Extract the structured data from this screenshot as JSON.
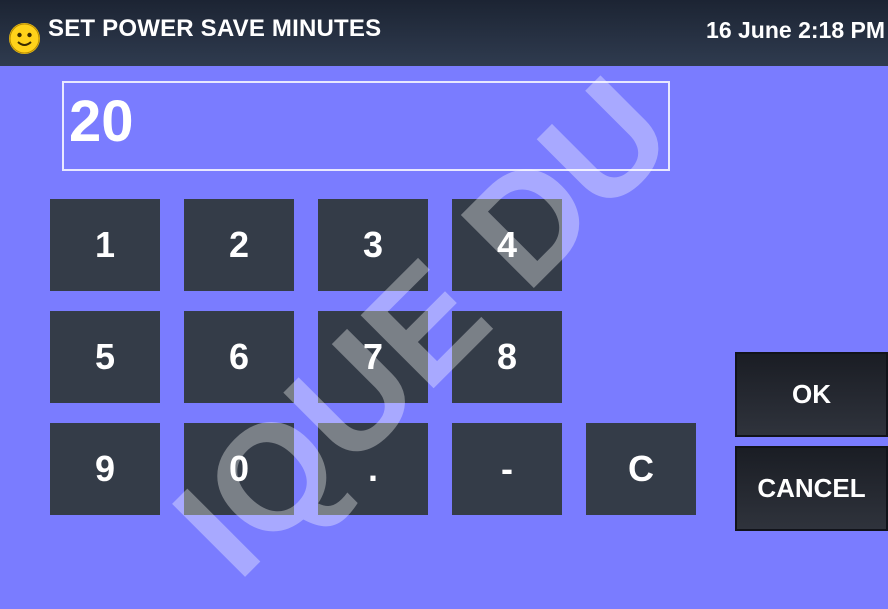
{
  "header": {
    "title": "SET POWER SAVE MINUTES",
    "datetime": "16 June 2:18 PM",
    "icon": "smiley-icon"
  },
  "display": {
    "value": "20"
  },
  "keypad": {
    "row1": [
      "1",
      "2",
      "3",
      "4"
    ],
    "row2": [
      "5",
      "6",
      "7",
      "8"
    ],
    "row3": [
      "9",
      "0",
      ".",
      "-",
      "C"
    ]
  },
  "actions": {
    "ok": "OK",
    "cancel": "CANCEL"
  },
  "watermark": {
    "text": "IQUE DU"
  },
  "colors": {
    "background": "#7a7cff",
    "header_bg": "#222b3a",
    "key_bg": "#343c48",
    "text": "#ffffff",
    "smiley": "#ffd21a"
  }
}
